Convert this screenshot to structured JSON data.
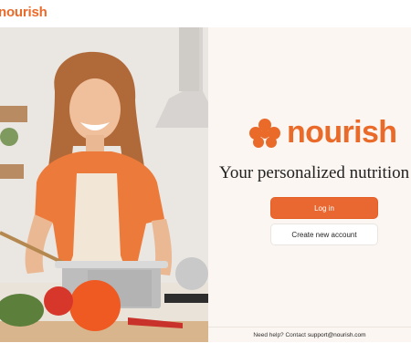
{
  "app": {
    "top_logo_text": "nourish",
    "brand_name": "nourish",
    "tagline": "Your personalized nutrition ca",
    "accent_color": "#ea6a2a"
  },
  "actions": {
    "login_label": "Log in",
    "create_account_label": "Create new account"
  },
  "footer": {
    "help_prefix": "Need help? Contact",
    "support_email": "support@nourish.com"
  },
  "icons": {
    "brand_icon": "flower-logo-icon"
  }
}
